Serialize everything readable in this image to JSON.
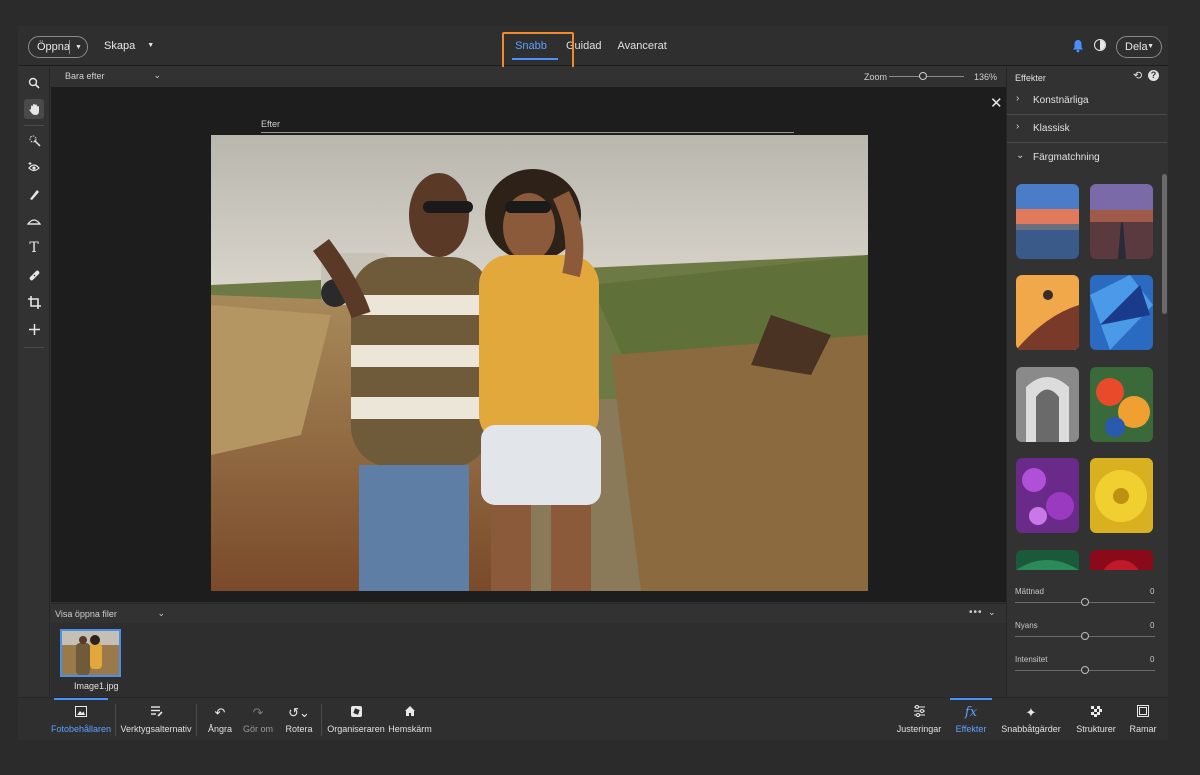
{
  "header": {
    "open_label": "Öppna",
    "create_label": "Skapa",
    "modes": [
      "Snabb",
      "Guidad",
      "Avancerat"
    ],
    "share_label": "Dela"
  },
  "toolbar": {
    "tools": [
      "zoom-icon",
      "hand-icon",
      "quick-selection-icon",
      "red-eye-icon",
      "whiten-teeth-icon",
      "straighten-icon",
      "text-icon",
      "spot-healing-icon",
      "crop-icon",
      "move-icon"
    ]
  },
  "canvas": {
    "view_mode": "Bara efter",
    "zoom_label": "Zoom",
    "zoom_value": "136%",
    "zoom_fraction": 0.45,
    "after_label": "Efter"
  },
  "photo_bin": {
    "select_label": "Visa öppna filer",
    "files": [
      {
        "name": "Image1.jpg"
      }
    ]
  },
  "effects_panel": {
    "title": "Effekter",
    "sections": [
      "Konstnärliga",
      "Klassisk",
      "Färgmatchning"
    ],
    "sliders": [
      {
        "name": "Mättnad",
        "value": "0"
      },
      {
        "name": "Nyans",
        "value": "0"
      },
      {
        "name": "Intensitet",
        "value": "0"
      }
    ]
  },
  "bottombar": {
    "left": [
      {
        "label": "Fotobehållaren",
        "icon": "photo-bin-icon",
        "active": true
      },
      {
        "label": "Verktygsalternativ",
        "icon": "tool-options-icon"
      },
      {
        "label": "Ångra",
        "icon": "undo-icon"
      },
      {
        "label": "Gör om",
        "icon": "redo-icon"
      },
      {
        "label": "Rotera",
        "icon": "rotate-icon"
      },
      {
        "label": "Organiseraren",
        "icon": "organizer-icon"
      },
      {
        "label": "Hemskärm",
        "icon": "home-icon"
      }
    ],
    "right": [
      {
        "label": "Justeringar",
        "icon": "adjustments-icon"
      },
      {
        "label": "Effekter",
        "icon": "effects-icon",
        "active": true
      },
      {
        "label": "Snabbåtgärder",
        "icon": "quick-actions-icon"
      },
      {
        "label": "Strukturer",
        "icon": "textures-icon"
      },
      {
        "label": "Ramar",
        "icon": "frames-icon"
      }
    ]
  },
  "colors": {
    "accent": "#4a90ff",
    "highlight": "#f08a2a"
  }
}
